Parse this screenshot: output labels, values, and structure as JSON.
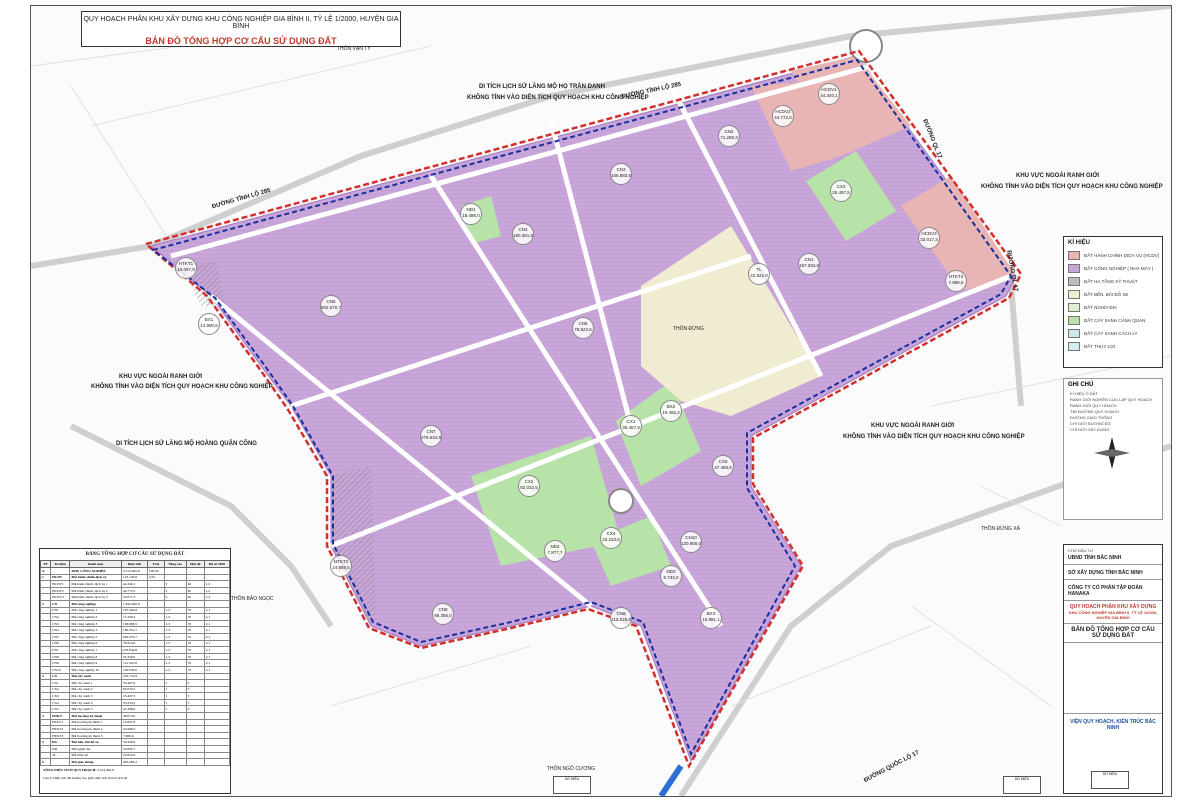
{
  "header": {
    "line1": "QUY HOẠCH PHÂN KHU XÂY DỰNG KHU CÔNG NGHIỆP GIA BÌNH II, TỶ LỆ 1/2000, HUYỆN GIA BÌNH",
    "line2": "BẢN ĐỒ TỔNG HỢP CƠ CẤU SỬ DỤNG ĐẤT"
  },
  "colors": {
    "industrial": "#c9a6d9",
    "industrial_hatch": "#a47bc0",
    "admin": "#e8b4b4",
    "green": "#b8e3a8",
    "village": "#efecd2",
    "water": "#cfe7ec",
    "road": "#ffffff",
    "boundary_red": "#d32f2f",
    "boundary_blue": "#1a2fa0"
  },
  "roads": {
    "tinh_lo_285_a": "ĐƯỜNG TỈNH LỘ 285",
    "tinh_lo_285_b": "ĐƯỜNG TỈNH LỘ 285",
    "ql17_a": "ĐƯỜNG QL 17",
    "ql17_b": "ĐƯỜNG QL 17",
    "ql17_c": "ĐƯỜNG QUỐC LỘ 17"
  },
  "place_labels": {
    "di_tich_1_l1": "DI TÍCH LỊCH SỬ LĂNG MỘ HỌ TRẦN DANH",
    "di_tich_1_l2": "KHÔNG TÍNH VÀO DIỆN TÍCH QUY HOẠCH KHU CÔNG NGHIỆP",
    "outside_ne_l1": "KHU VỰC NGOÀI RANH GIỚI",
    "outside_ne_l2": "KHÔNG TÍNH VÀO DIỆN TÍCH QUY HOẠCH KHU CÔNG NGHIỆP",
    "outside_w_l1": "KHU VỰC NGOÀI RANH GIỚI",
    "outside_w_l2": "KHÔNG TÍNH VÀO DIỆN TÍCH QUY HOẠCH KHU CÔNG NGHIỆP",
    "di_tich_2": "DI TÍCH LỊCH SỬ LĂNG MỘ HOÀNG QUẬN CÔNG",
    "outside_e_l1": "KHU VỰC NGOÀI RANH GIỚI",
    "outside_e_l2": "KHÔNG TÍNH VÀO DIỆN TÍCH QUY HOẠCH KHU CÔNG NGHIỆP",
    "thon_van_ty": "THÔN VẠN TY",
    "thon_dung": "THÔN ĐỪNG",
    "thon_bao_ngoc": "THÔN BẢO NGỌC",
    "thon_dung_xa": "THÔN ĐỪNG XÁ",
    "thon_ngo_cuong": "THÔN NGÔ CƯƠNG"
  },
  "zones": [
    {
      "code": "HCDV1",
      "area": "44.340,1"
    },
    {
      "code": "HCDV2",
      "area": "44.772,5"
    },
    {
      "code": "HCDV3",
      "area": "33.017,3"
    },
    {
      "code": "CN1",
      "area": "197.294,8"
    },
    {
      "code": "CN2",
      "area": "71.289,3"
    },
    {
      "code": "CN3",
      "area": "106.883,5"
    },
    {
      "code": "CN4",
      "area": "180.351,5"
    },
    {
      "code": "CN5",
      "area": "602.670,7"
    },
    {
      "code": "CN6",
      "area": "78.523,6"
    },
    {
      "code": "CN7",
      "area": "276.634,8"
    },
    {
      "code": "CN8",
      "area": "95.356,0"
    },
    {
      "code": "CN9",
      "area": "112.525,8"
    },
    {
      "code": "CN10",
      "area": "120.950,0"
    },
    {
      "code": "CX1",
      "area": "35.467,9"
    },
    {
      "code": "CX2",
      "area": "92.032,5"
    },
    {
      "code": "CX3",
      "area": "25.497,5"
    },
    {
      "code": "CX4",
      "area": "33.233,5"
    },
    {
      "code": "CX5",
      "area": "47.488,6"
    },
    {
      "code": "ND1",
      "area": "18.485,0"
    },
    {
      "code": "ND2",
      "area": "7.877,7"
    },
    {
      "code": "ND3",
      "area": "6.733,0"
    },
    {
      "code": "HTKT1",
      "area": "15.097,9"
    },
    {
      "code": "HTKT2",
      "area": "24.988,5"
    },
    {
      "code": "HTKT3",
      "area": "7.986,6"
    },
    {
      "code": "BX1",
      "area": "14.990,6"
    },
    {
      "code": "BX2",
      "area": "19.465,2"
    },
    {
      "code": "BX3",
      "area": "15.881,1"
    },
    {
      "code": "TL",
      "area": "22.822,0"
    }
  ],
  "legend": {
    "title": "KÍ HIỆU",
    "items": [
      {
        "label": "ĐẤT HÀNH CHÍNH DỊCH VỤ (HCDV)",
        "color": "#e8b4b4"
      },
      {
        "label": "ĐẤT CÔNG NGHIỆP ( NHÀ MÁY )",
        "color": "#c9a6d9"
      },
      {
        "label": "ĐẤT HẠ TẦNG KỸ THUẬT",
        "color": "#bdbdbd"
      },
      {
        "label": "ĐẤT BẾN, BÃI ĐỖ XE",
        "color": "#efecd2"
      },
      {
        "label": "ĐẤT NGHĨA ĐỊA",
        "color": "#dff0d0"
      },
      {
        "label": "ĐẤT CÂY XANH CẢNH QUAN",
        "color": "#b8e3a8"
      },
      {
        "label": "ĐẤT CÂY XANH CÁCH LY",
        "color": "#cfe7ec"
      },
      {
        "label": "ĐẤT THỦY LỢI",
        "color": "#d6ecf3"
      }
    ]
  },
  "notes": {
    "title": "GHI CHÚ",
    "items": [
      "KÍ HIỆU Ô ĐẤT",
      "RANH GIỚI NGHIÊN CỨU LẬP QUY HOẠCH",
      "RANH GIỚI QUY HOẠCH",
      "TIM ĐƯỜNG QUY HOẠCH",
      "ĐƯỜNG GIAO THÔNG",
      "CHỈ GIỚI ĐƯỜNG ĐỎ",
      "CHỈ GIỚI XÂY DỰNG"
    ]
  },
  "titleblock": {
    "client_label": "CHỦ ĐẦU TƯ",
    "client": "UBND TỈNH BẮC NINH",
    "agency1": "SỞ XÂY DỰNG TỈNH BẮC NINH",
    "agency2": "CÔNG TY CỔ PHẦN TẬP ĐOÀN HANAKA",
    "project_title": "QUY HOẠCH PHÂN KHU XÂY DỰNG",
    "project_sub": "KHU CÔNG NGHIỆP GIA BÌNH II, TỶ LỆ 1/2000, HUYỆN GIA BÌNH",
    "sheet_name": "BẢN ĐỒ TỔNG HỢP CƠ CẤU SỬ DỤNG ĐẤT",
    "designer": "VIỆN QUY HOẠCH, KIẾN TRÚC BẮC NINH"
  },
  "table": {
    "caption": "BẢNG TỔNG HỢP CƠ CẤU SỬ DỤNG ĐẤT",
    "headers": [
      "TT",
      "Kí hiệu",
      "Danh mục",
      "Diện tích",
      "Tỉ lệ",
      "Tầng cao",
      "Mật độ",
      "Hệ số SDĐ"
    ],
    "rows": [
      [
        "A",
        "",
        "KHU CÔNG NGHIỆP",
        "2.214.465,8",
        "100,00",
        "",
        "",
        ""
      ],
      [
        "1",
        "HCDV",
        "Đất hành chính dịch vụ",
        "122.129,9",
        "5,52",
        "",
        "",
        ""
      ],
      [
        "",
        "HCDV1",
        "Đất hành chính, dịch vụ 1",
        "44.340,1",
        "",
        "3",
        "40",
        "1,2"
      ],
      [
        "",
        "HCDV2",
        "Đất hành chính, dịch vụ 2",
        "44.772,5",
        "",
        "3",
        "40",
        "1,2"
      ],
      [
        "",
        "HCDV3",
        "Đất hành chính, dịch vụ 3",
        "33.017,3",
        "",
        "3",
        "40",
        "1,2"
      ],
      [
        "2",
        "CN",
        "Đất công nghiệp",
        "1.842.480,0",
        "",
        "",
        "",
        ""
      ],
      [
        "",
        "CN1",
        "Đất công nghiệp 1",
        "197.294,8",
        "",
        "1-5",
        "70",
        "2,1"
      ],
      [
        "",
        "CN2",
        "Đất công nghiệp 2",
        "71.289,3",
        "",
        "1-5",
        "70",
        "2,1"
      ],
      [
        "",
        "CN3",
        "Đất công nghiệp 3",
        "106.883,5",
        "",
        "1-5",
        "70",
        "2,1"
      ],
      [
        "",
        "CN4",
        "Đất công nghiệp 4",
        "180.351,5",
        "",
        "1-5",
        "70",
        "2,1"
      ],
      [
        "",
        "CN5",
        "Đất công nghiệp 5",
        "602.670,7",
        "",
        "1-5",
        "70",
        "2,1"
      ],
      [
        "",
        "CN6",
        "Đất công nghiệp 6",
        "78.523,6",
        "",
        "1-5",
        "70",
        "2,1"
      ],
      [
        "",
        "CN7",
        "Đất công nghiệp 7",
        "276.634,8",
        "",
        "1-5",
        "70",
        "2,1"
      ],
      [
        "",
        "CN8",
        "Đất công nghiệp 8",
        "95.356,0",
        "",
        "1-5",
        "70",
        "2,1"
      ],
      [
        "",
        "CN9",
        "Đất công nghiệp 9",
        "112.525,8",
        "",
        "1-5",
        "70",
        "2,1"
      ],
      [
        "",
        "CN10",
        "Đất công nghiệp 10",
        "120.950,0",
        "",
        "1-5",
        "70",
        "2,1"
      ],
      [
        "3",
        "CX",
        "Đất cây xanh",
        "233.719,9",
        "",
        "",
        "",
        ""
      ],
      [
        "",
        "CX1",
        "Đất cây xanh 1",
        "35.467,9",
        "",
        "1",
        "5",
        ""
      ],
      [
        "",
        "CX2",
        "Đất cây xanh 2",
        "92.032,5",
        "",
        "1",
        "5",
        ""
      ],
      [
        "",
        "CX3",
        "Đất cây xanh 3",
        "25.497,5",
        "",
        "1",
        "5",
        ""
      ],
      [
        "",
        "CX4",
        "Đất cây xanh 4",
        "33.233,5",
        "",
        "1",
        "5",
        ""
      ],
      [
        "",
        "CX5",
        "Đất cây xanh 5",
        "47.488,6",
        "",
        "1",
        "5",
        ""
      ],
      [
        "4",
        "HTKT",
        "Đất hạ tầng kỹ thuật",
        "48.073,0",
        "",
        "",
        "",
        ""
      ],
      [
        "",
        "HTKT1",
        "Đất hạ tầng kỹ thuật 1",
        "15.097,9",
        "",
        "",
        "",
        ""
      ],
      [
        "",
        "HTKT2",
        "Đất hạ tầng kỹ thuật 2",
        "24.988,5",
        "",
        "",
        "",
        ""
      ],
      [
        "",
        "HTKT3",
        "Đất hạ tầng kỹ thuật 3",
        "7.986,6",
        "",
        "",
        "",
        ""
      ],
      [
        "5",
        "BX",
        "Đất bến, bãi đỗ xe",
        "50.336,9",
        "",
        "",
        "",
        ""
      ],
      [
        "",
        "ND",
        "Đất nghĩa địa",
        "33.095,7",
        "",
        "",
        "",
        ""
      ],
      [
        "",
        "TL",
        "Đất thủy lợi",
        "22.822,0",
        "",
        "",
        "",
        ""
      ],
      [
        "6",
        "",
        "Đất giao thông",
        "405.068,2",
        "",
        "",
        "",
        ""
      ]
    ],
    "total_label": "TỔNG DIỆN TÍCH QUY HOẠCH",
    "total_value": "2.214.465,8",
    "footnote": "Lưu ý: Diện tích đất không bao gồm diện tích di tích lịch sử"
  },
  "sign_boxes": {
    "a": "SỐ HIỆU",
    "b": "SỐ HIỆU",
    "c": "SỐ HIỆU"
  }
}
